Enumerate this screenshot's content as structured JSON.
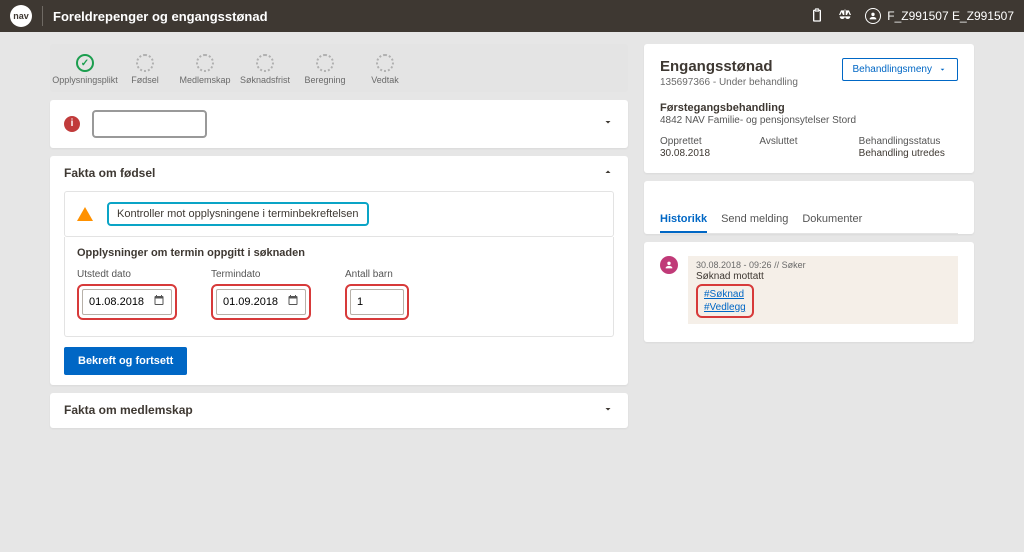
{
  "app": {
    "title": "Foreldrepenger og engangsstønad",
    "userName": "F_Z991507 E_Z991507"
  },
  "steps": [
    {
      "label": "Opplysningsplikt",
      "done": true
    },
    {
      "label": "Fødsel",
      "done": false
    },
    {
      "label": "Medlemskap",
      "done": false
    },
    {
      "label": "Søknadsfrist",
      "done": false
    },
    {
      "label": "Beregning",
      "done": false
    },
    {
      "label": "Vedtak",
      "done": false
    }
  ],
  "birthPanel": {
    "title": "Fakta om fødsel",
    "alert": "Kontroller mot opplysningene i terminbekreftelsen",
    "sectionTitle": "Opplysninger om termin oppgitt i søknaden",
    "fields": {
      "utstedtLabel": "Utstedt dato",
      "utstedtValue": "01.08.2018",
      "terminLabel": "Termindato",
      "terminValue": "01.09.2018",
      "antallLabel": "Antall barn",
      "antallValue": "1"
    },
    "confirmLabel": "Bekreft og fortsett"
  },
  "membershipPanel": {
    "title": "Fakta om medlemskap"
  },
  "case": {
    "title": "Engangsstønad",
    "subtitle": "135697366 - Under behandling",
    "menuLabel": "Behandlingsmeny",
    "behandlingType": "Førstegangsbehandling",
    "enhet": "4842 NAV Familie- og pensjonsytelser Stord",
    "cols": {
      "opprettetLabel": "Opprettet",
      "opprettetValue": "30.08.2018",
      "avsluttetLabel": "Avsluttet",
      "avsluttetValue": "",
      "statusLabel": "Behandlingsstatus",
      "statusValue": "Behandling utredes"
    }
  },
  "tabs": {
    "historikk": "Historikk",
    "sendMelding": "Send melding",
    "dokumenter": "Dokumenter"
  },
  "history": {
    "meta": "30.08.2018 - 09:26 // Søker",
    "title": "Søknad mottatt",
    "link1": "#Søknad",
    "link2": "#Vedlegg"
  }
}
